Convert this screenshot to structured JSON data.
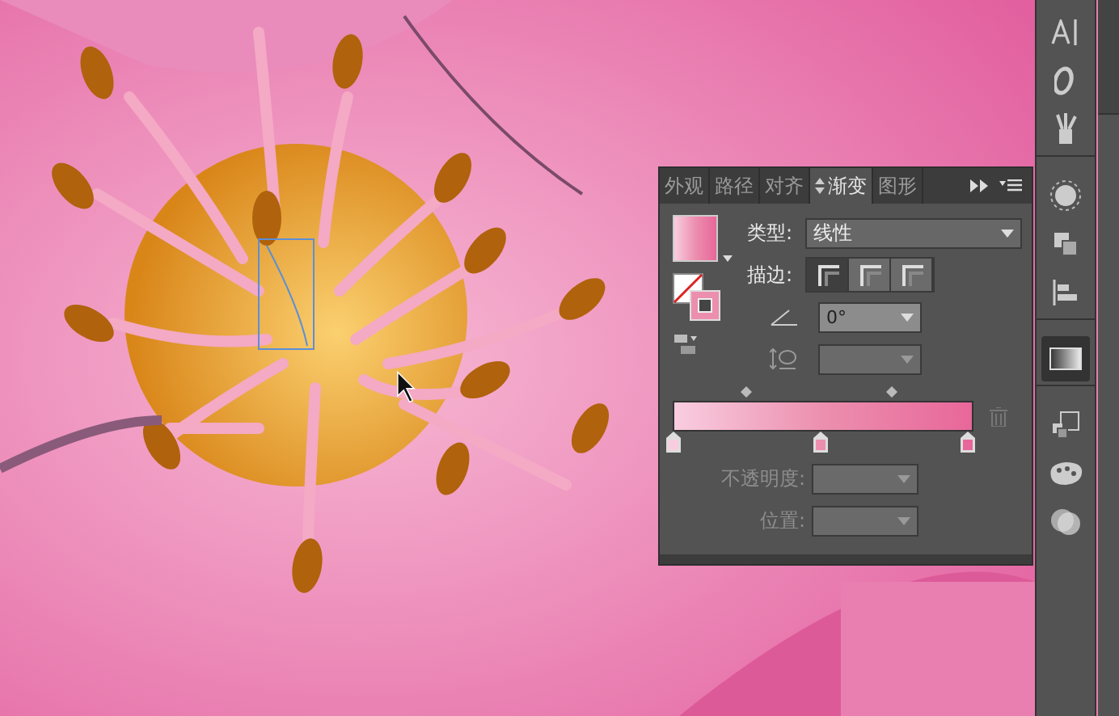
{
  "panel": {
    "tabs": [
      {
        "label": "外观",
        "selected": false
      },
      {
        "label": "路径",
        "selected": false
      },
      {
        "label": "对齐",
        "selected": false
      },
      {
        "label": "渐变",
        "selected": true
      },
      {
        "label": "图形",
        "selected": false
      }
    ],
    "type_label": "类型:",
    "type_value": "线性",
    "stroke_label": "描边:",
    "stroke_buttons": [
      {
        "selected": true
      },
      {
        "selected": false
      },
      {
        "selected": false
      }
    ],
    "angle_value": "0°",
    "aspect_disabled": true,
    "stops": [
      {
        "color": "#f9cde0",
        "selected": false
      },
      {
        "color": "#ec8fae",
        "selected": false
      },
      {
        "color": "#e8679a",
        "selected": false
      }
    ],
    "opacity_label": "不透明度:",
    "position_label": "位置:",
    "stop_fields_disabled": true
  },
  "dock": [
    {
      "kind": "character",
      "selected": false
    },
    {
      "kind": "glyph",
      "selected": false
    },
    {
      "kind": "brushes",
      "selected": false
    },
    {
      "kind": "appearance",
      "selected": false
    },
    {
      "kind": "pathfinder",
      "selected": false
    },
    {
      "kind": "align",
      "selected": false
    },
    {
      "kind": "gradient",
      "selected": true
    },
    {
      "kind": "transform",
      "selected": false
    },
    {
      "kind": "swatches",
      "selected": false
    },
    {
      "kind": "transparency",
      "selected": false
    }
  ]
}
